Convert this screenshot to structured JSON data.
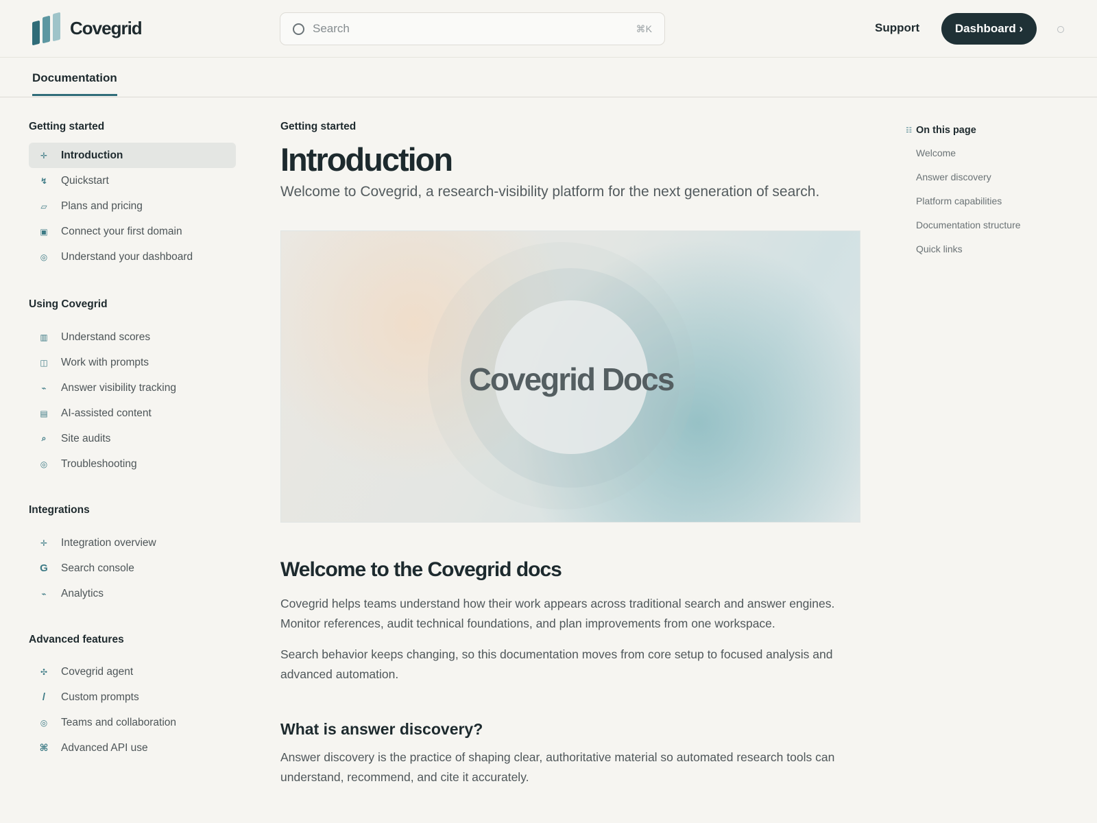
{
  "header": {
    "brand": "Covegrid",
    "search": {
      "placeholder": "Search",
      "shortcut": "⌘K"
    },
    "support_label": "Support",
    "dashboard_label": "Dashboard ›"
  },
  "tabs": [
    {
      "label": "Documentation",
      "active": true
    }
  ],
  "sidebar": {
    "sections": [
      {
        "heading": "Getting started",
        "items": [
          {
            "label": "Introduction",
            "icon": "sparkle-icon",
            "active": true
          },
          {
            "label": "Quickstart",
            "icon": "lightning-icon"
          },
          {
            "label": "Plans and pricing",
            "icon": "tag-icon"
          },
          {
            "label": "Connect your first domain",
            "icon": "square-icon"
          },
          {
            "label": "Understand your dashboard",
            "icon": "circle-icon"
          }
        ]
      },
      {
        "heading": "Using Covegrid",
        "items": [
          {
            "label": "Understand scores",
            "icon": "grid-icon"
          },
          {
            "label": "Work with prompts",
            "icon": "columns-icon"
          },
          {
            "label": "Answer visibility tracking",
            "icon": "trend-icon"
          },
          {
            "label": "AI-assisted content",
            "icon": "list-icon"
          },
          {
            "label": "Site audits",
            "icon": "magnifier-icon"
          },
          {
            "label": "Troubleshooting",
            "icon": "circle-icon"
          }
        ]
      },
      {
        "heading": "Integrations",
        "items": [
          {
            "label": "Integration overview",
            "icon": "plus-icon"
          },
          {
            "label": "Search console",
            "icon": "g-icon"
          },
          {
            "label": "Analytics",
            "icon": "trend-icon"
          }
        ]
      },
      {
        "heading": "Advanced features",
        "items": [
          {
            "label": "Covegrid agent",
            "icon": "move-icon"
          },
          {
            "label": "Custom prompts",
            "icon": "slash-icon"
          },
          {
            "label": "Teams and collaboration",
            "icon": "circle-icon"
          },
          {
            "label": "Advanced API use",
            "icon": "command-icon"
          }
        ]
      }
    ]
  },
  "main": {
    "eyebrow": "Getting started",
    "title": "Introduction",
    "lead": "Welcome to Covegrid, a research-visibility platform for the next generation of search.",
    "hero_title": "Covegrid Docs",
    "h2": "Welcome to the Covegrid docs",
    "p1": "Covegrid helps teams understand how their work appears across traditional search and answer engines. Monitor references, audit technical foundations, and plan improvements from one workspace.",
    "p2": "Search behavior keeps changing, so this documentation moves from core setup to focused analysis and advanced automation.",
    "h3": "What is answer discovery?",
    "p3": "Answer discovery is the practice of shaping clear, authoritative material so automated research tools can understand, recommend, and cite it accurately."
  },
  "toc": {
    "heading": "On this page",
    "items": [
      "Welcome",
      "Answer discovery",
      "Platform capabilities",
      "Documentation structure",
      "Quick links"
    ]
  },
  "colors": {
    "accent": "#2f6c78",
    "button_bg": "#1f3136",
    "background": "#f6f5f1"
  }
}
